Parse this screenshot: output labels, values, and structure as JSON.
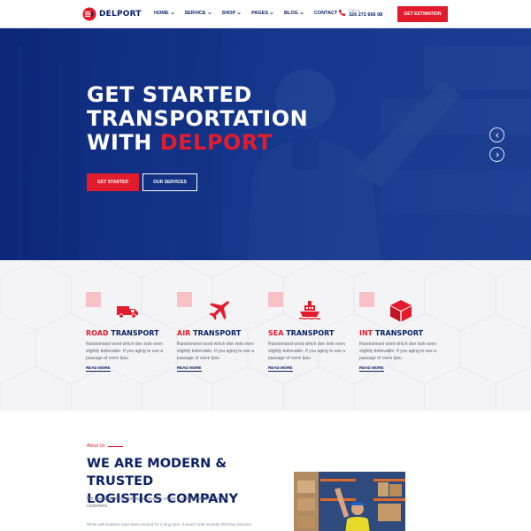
{
  "brand": {
    "name": "DELPORT",
    "accent": "#e31c2d",
    "primary": "#0a2266"
  },
  "nav": {
    "items": [
      {
        "label": "HOME",
        "dropdown": true
      },
      {
        "label": "SERVICE",
        "dropdown": true
      },
      {
        "label": "SHOP",
        "dropdown": true
      },
      {
        "label": "PAGES",
        "dropdown": true
      },
      {
        "label": "BLOG",
        "dropdown": true
      },
      {
        "label": "CONTACT",
        "dropdown": false
      }
    ]
  },
  "contact": {
    "label": "Call Us",
    "phone": "326 272 666 08",
    "icon": "phone-icon"
  },
  "header": {
    "cta_label": "GET ESTIMATION"
  },
  "hero": {
    "line1": "GET STARTED",
    "line2": "TRANSPORTATION",
    "line3_prefix": "WITH",
    "line3_accent": "DELPORT",
    "primary_button": "GET STARTED",
    "secondary_button": "OUR SERVICES",
    "prev_icon": "chevron-left-icon",
    "next_icon": "chevron-right-icon"
  },
  "services": [
    {
      "accent": "ROAD",
      "rest": " TRANSPORT",
      "icon": "truck-icon",
      "desc": "Randomised word which don look even slightly believable. If you aging to use a passage of orem Ipsu",
      "link": "READ MORE"
    },
    {
      "accent": "AIR",
      "rest": " TRANSPORT",
      "icon": "airplane-icon",
      "desc": "Randomised word which don look even slightly believable. If you aging to use a passage of orem Ipsu",
      "link": "READ MORE"
    },
    {
      "accent": "SEA",
      "rest": " TRANSPORT",
      "icon": "ship-icon",
      "desc": "Randomised word which don look even slightly believable. If you aging to use a passage of orem Ipsu",
      "link": "READ MORE"
    },
    {
      "accent": "INT",
      "rest": " TRANSPORT",
      "icon": "box-icon",
      "desc": "Randomised word which don look even slightly believable. If you aging to use a passage of orem Ipsu",
      "link": "READ MORE"
    }
  ],
  "about": {
    "label": "About Us",
    "title_line1": "WE ARE MODERN & TRUSTED",
    "title_line2": "LOGISTICS COMPANY",
    "text": "We specialize in combining services to create a unique solution to reach customers.",
    "text2": "While web builders have been around for a long time, it wasn't until recently that they became"
  }
}
